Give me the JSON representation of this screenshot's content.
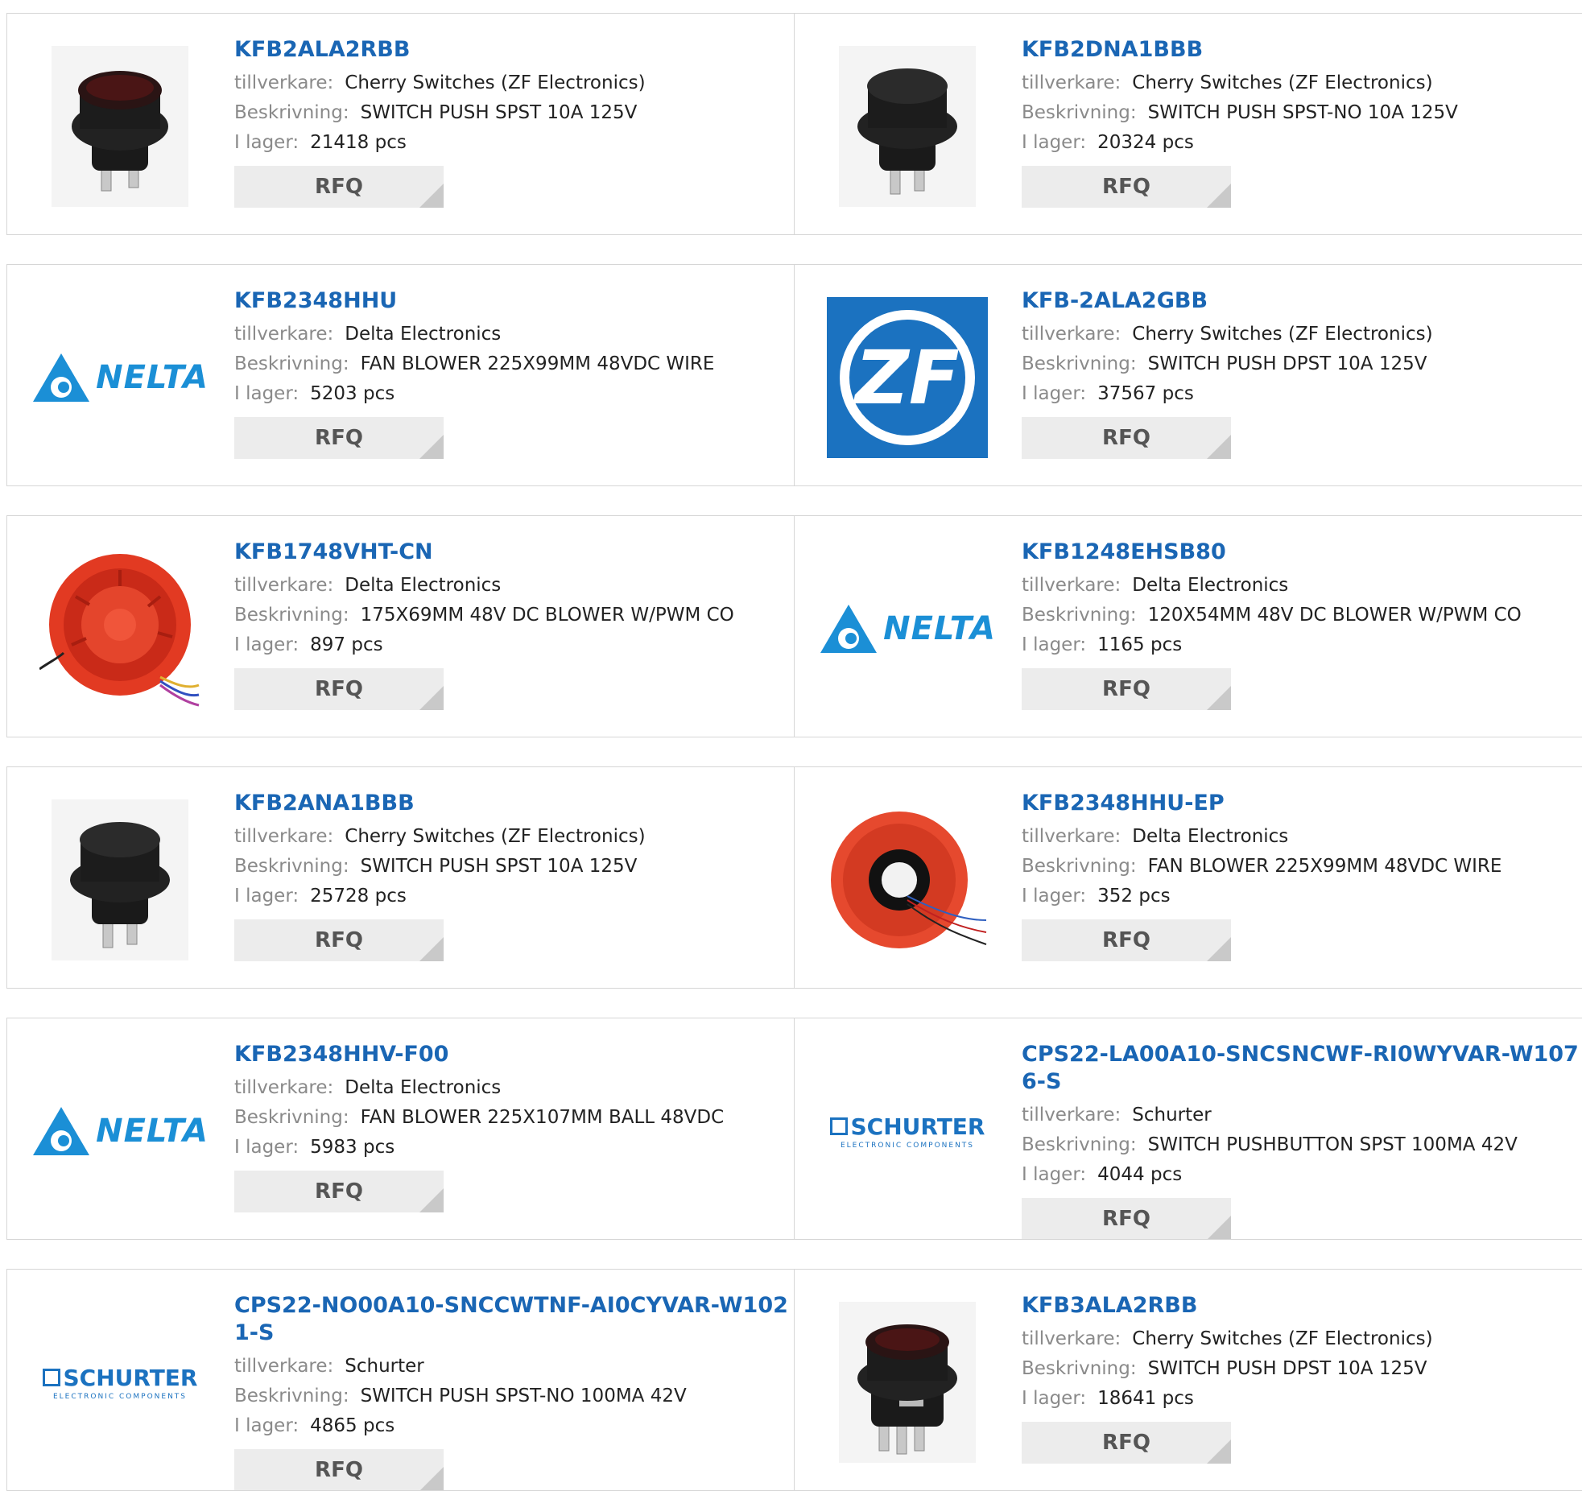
{
  "labels": {
    "manufacturer": "tillverkare:",
    "description": "Beskrivning:",
    "stock": "I lager:",
    "rfq": "RFQ"
  },
  "products": [
    {
      "pn": "KFB2ALA2RBB",
      "mfr": "Cherry Switches (ZF Electronics)",
      "desc": "SWITCH PUSH SPST 10A 125V",
      "stock": "21418 pcs",
      "image": "push-switch-red-icon"
    },
    {
      "pn": "KFB2DNA1BBB",
      "mfr": "Cherry Switches (ZF Electronics)",
      "desc": "SWITCH PUSH SPST-NO 10A 125V",
      "stock": "20324 pcs",
      "image": "push-switch-black-icon"
    },
    {
      "pn": "KFB2348HHU",
      "mfr": "Delta Electronics",
      "desc": "FAN BLOWER 225X99MM 48VDC WIRE",
      "stock": "5203 pcs",
      "image": "delta-logo",
      "logo_text": "NELTA"
    },
    {
      "pn": "KFB-2ALA2GBB",
      "mfr": "Cherry Switches (ZF Electronics)",
      "desc": "SWITCH PUSH DPST 10A 125V",
      "stock": "37567 pcs",
      "image": "zf-logo",
      "logo_text": "ZF"
    },
    {
      "pn": "KFB1748VHT-CN",
      "mfr": "Delta Electronics",
      "desc": "175X69MM 48V DC BLOWER W/PWM CO",
      "stock": "897 pcs",
      "image": "red-blower-icon"
    },
    {
      "pn": "KFB1248EHSB80",
      "mfr": "Delta Electronics",
      "desc": "120X54MM 48V DC BLOWER W/PWM CO",
      "stock": "1165 pcs",
      "image": "delta-logo",
      "logo_text": "NELTA"
    },
    {
      "pn": "KFB2ANA1BBB",
      "mfr": "Cherry Switches (ZF Electronics)",
      "desc": "SWITCH PUSH SPST 10A 125V",
      "stock": "25728 pcs",
      "image": "push-switch-black-icon"
    },
    {
      "pn": "KFB2348HHU-EP",
      "mfr": "Delta Electronics",
      "desc": "FAN BLOWER 225X99MM 48VDC WIRE",
      "stock": "352 pcs",
      "image": "red-blower-front-icon"
    },
    {
      "pn": "KFB2348HHV-F00",
      "mfr": "Delta Electronics",
      "desc": "FAN BLOWER 225X107MM BALL 48VDC",
      "stock": "5983 pcs",
      "image": "delta-logo",
      "logo_text": "NELTA"
    },
    {
      "pn": "CPS22-LA00A10-SNCSNCWF-RI0WYVAR-W1076-S",
      "mfr": "Schurter",
      "desc": "SWITCH PUSHBUTTON SPST 100MA 42V",
      "stock": "4044 pcs",
      "image": "schurter-logo",
      "logo_text": "SCHURTER",
      "logo_sub": "ELECTRONIC COMPONENTS"
    },
    {
      "pn": "CPS22-NO00A10-SNCCWTNF-AI0CYVAR-W1021-S",
      "mfr": "Schurter",
      "desc": "SWITCH PUSH SPST-NO 100MA 42V",
      "stock": "4865 pcs",
      "image": "schurter-logo",
      "logo_text": "SCHURTER",
      "logo_sub": "ELECTRONIC COMPONENTS"
    },
    {
      "pn": "KFB3ALA2RBB",
      "mfr": "Cherry Switches (ZF Electronics)",
      "desc": "SWITCH PUSH DPST 10A 125V",
      "stock": "18641 pcs",
      "image": "push-switch-dpst-icon"
    }
  ]
}
